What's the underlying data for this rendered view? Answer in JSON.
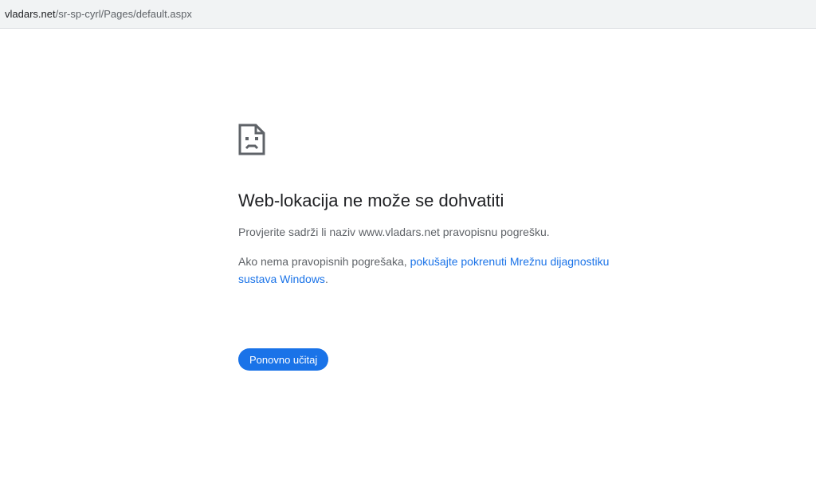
{
  "address_bar": {
    "host": "vladars.net",
    "path": "/sr-sp-cyrl/Pages/default.aspx"
  },
  "error": {
    "icon": "sad-page-icon",
    "title": "Web-lokacija ne može se dohvatiti",
    "message": "Provjerite sadrži li naziv www.vladars.net pravopisnu pogrešku.",
    "hint_prefix": "Ako nema pravopisnih pogrešaka, ",
    "hint_link": "pokušajte pokrenuti Mrežnu dijagnostiku sustava Windows",
    "hint_suffix": ".",
    "reload_label": "Ponovno učitaj"
  },
  "colors": {
    "accent": "#1a73e8",
    "text_primary": "#202124",
    "text_secondary": "#5f6368"
  }
}
